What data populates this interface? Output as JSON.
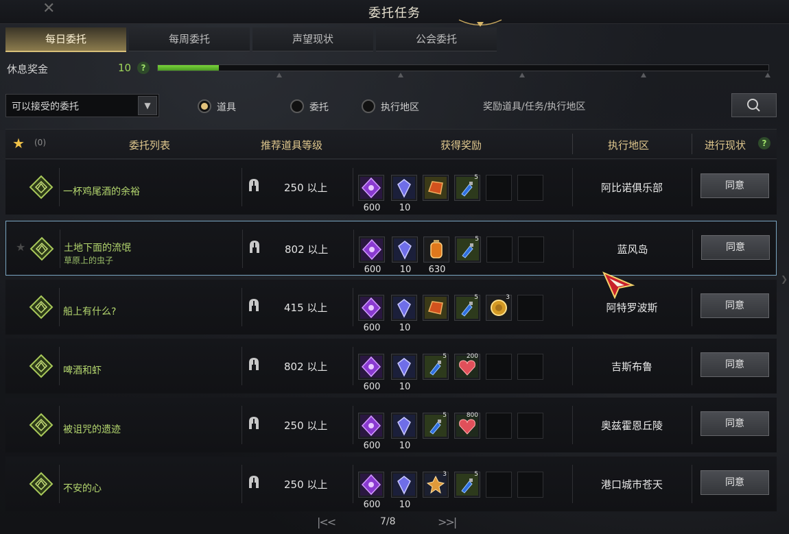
{
  "window": {
    "title": "委托任务"
  },
  "tabs": [
    "每日委托",
    "每周委托",
    "声望现状",
    "公会委托"
  ],
  "rest_bonus": {
    "label": "休息奖金",
    "value": "10",
    "fill_fraction": 0.1
  },
  "filter": {
    "dropdown_value": "可以接受的委托",
    "radios": [
      "道具",
      "委托",
      "执行地区"
    ],
    "selected_radio": "道具",
    "search_placeholder": "奖励道具/任务/执行地区"
  },
  "table": {
    "favorite_count": "(0)",
    "headers": [
      "委托列表",
      "推荐道具等级",
      "获得奖励",
      "执行地区",
      "进行现状"
    ],
    "rows": [
      {
        "name": "一杯鸡尾酒的余裕",
        "sub": "",
        "level": "250 以上",
        "location": "阿比诺俱乐部",
        "action": "同意",
        "selected": false,
        "rewards": [
          {
            "icon": "purple-shard-icon",
            "qty": "600",
            "sup": ""
          },
          {
            "icon": "blue-crystal-icon",
            "qty": "10",
            "sup": ""
          },
          {
            "icon": "red-ore-icon",
            "qty": "",
            "sup": ""
          },
          {
            "icon": "blue-potion-icon",
            "qty": "",
            "sup": "5"
          },
          {
            "icon": "",
            "qty": "",
            "sup": ""
          },
          {
            "icon": "",
            "qty": "",
            "sup": ""
          }
        ]
      },
      {
        "name": "土地下面的流氓",
        "sub": "草原上的虫子",
        "level": "802 以上",
        "location": "蓝风岛",
        "action": "同意",
        "selected": true,
        "rewards": [
          {
            "icon": "purple-shard-icon",
            "qty": "600",
            "sup": ""
          },
          {
            "icon": "blue-crystal-icon",
            "qty": "10",
            "sup": ""
          },
          {
            "icon": "orange-lantern-icon",
            "qty": "630",
            "sup": ""
          },
          {
            "icon": "blue-potion-icon",
            "qty": "",
            "sup": "5"
          },
          {
            "icon": "",
            "qty": "",
            "sup": ""
          },
          {
            "icon": "",
            "qty": "",
            "sup": ""
          }
        ]
      },
      {
        "name": "船上有什么?",
        "sub": "",
        "level": "415 以上",
        "location": "阿特罗波斯",
        "action": "同意",
        "selected": false,
        "rewards": [
          {
            "icon": "purple-shard-icon",
            "qty": "600",
            "sup": ""
          },
          {
            "icon": "blue-crystal-icon",
            "qty": "10",
            "sup": ""
          },
          {
            "icon": "red-ore-icon",
            "qty": "",
            "sup": ""
          },
          {
            "icon": "blue-potion-icon",
            "qty": "",
            "sup": "5"
          },
          {
            "icon": "gold-coin-icon",
            "qty": "",
            "sup": "3"
          },
          {
            "icon": "",
            "qty": "",
            "sup": ""
          }
        ]
      },
      {
        "name": "啤酒和虾",
        "sub": "",
        "level": "802 以上",
        "location": "吉斯布鲁",
        "action": "同意",
        "selected": false,
        "rewards": [
          {
            "icon": "purple-shard-icon",
            "qty": "600",
            "sup": ""
          },
          {
            "icon": "blue-crystal-icon",
            "qty": "10",
            "sup": ""
          },
          {
            "icon": "blue-potion-icon",
            "qty": "",
            "sup": "5"
          },
          {
            "icon": "red-heart-icon",
            "qty": "",
            "sup": "200"
          },
          {
            "icon": "",
            "qty": "",
            "sup": ""
          },
          {
            "icon": "",
            "qty": "",
            "sup": ""
          }
        ]
      },
      {
        "name": "被诅咒的遗迹",
        "sub": "",
        "level": "250 以上",
        "location": "奥兹霍恩丘陵",
        "action": "同意",
        "selected": false,
        "rewards": [
          {
            "icon": "purple-shard-icon",
            "qty": "600",
            "sup": ""
          },
          {
            "icon": "blue-crystal-icon",
            "qty": "10",
            "sup": ""
          },
          {
            "icon": "blue-potion-icon",
            "qty": "",
            "sup": "5"
          },
          {
            "icon": "red-heart-icon",
            "qty": "",
            "sup": "800"
          },
          {
            "icon": "",
            "qty": "",
            "sup": ""
          },
          {
            "icon": "",
            "qty": "",
            "sup": ""
          }
        ]
      },
      {
        "name": "不安的心",
        "sub": "",
        "level": "250 以上",
        "location": "港口城市苍天",
        "action": "同意",
        "selected": false,
        "rewards": [
          {
            "icon": "purple-shard-icon",
            "qty": "600",
            "sup": ""
          },
          {
            "icon": "blue-crystal-icon",
            "qty": "10",
            "sup": ""
          },
          {
            "icon": "gold-flower-icon",
            "qty": "",
            "sup": "3"
          },
          {
            "icon": "blue-potion-icon",
            "qty": "",
            "sup": "5"
          },
          {
            "icon": "",
            "qty": "",
            "sup": ""
          },
          {
            "icon": "",
            "qty": "",
            "sup": ""
          }
        ]
      }
    ]
  },
  "pager": {
    "text": "7/8"
  },
  "colors": {
    "accent_gold": "#e0c88e",
    "quest_green": "#b5d86f",
    "progress_green": "#7ad43a"
  }
}
